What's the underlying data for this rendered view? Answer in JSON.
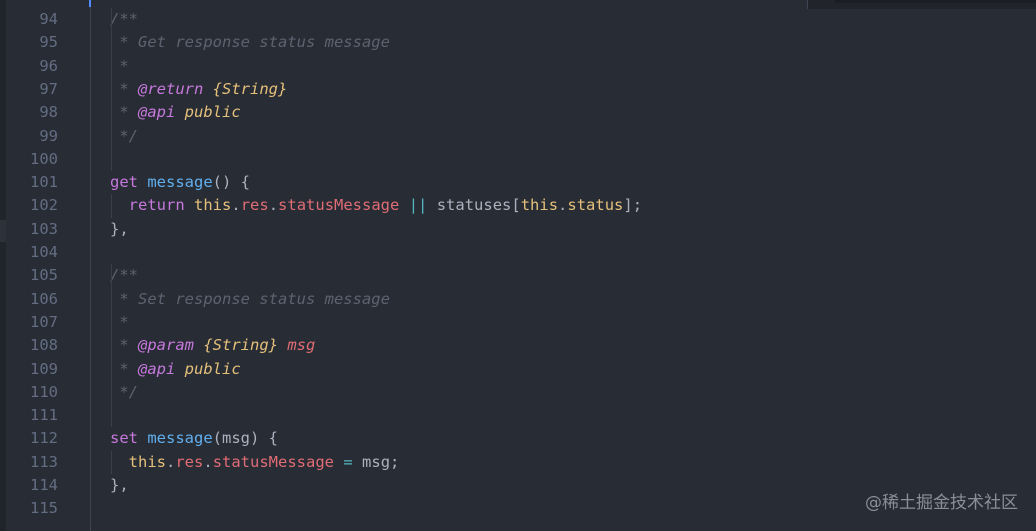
{
  "editor": {
    "lines": [
      {
        "number": "94",
        "tokens": [
          {
            "t": "/**",
            "c": "comment"
          }
        ]
      },
      {
        "number": "95",
        "tokens": [
          {
            "t": " * Get response status message",
            "c": "comment"
          }
        ]
      },
      {
        "number": "96",
        "tokens": [
          {
            "t": " *",
            "c": "comment"
          }
        ]
      },
      {
        "number": "97",
        "tokens": [
          {
            "t": " * ",
            "c": "comment"
          },
          {
            "t": "@return",
            "c": "tag"
          },
          {
            "t": " ",
            "c": "comment"
          },
          {
            "t": "{String}",
            "c": "type"
          }
        ]
      },
      {
        "number": "98",
        "tokens": [
          {
            "t": " * ",
            "c": "comment"
          },
          {
            "t": "@api",
            "c": "tag"
          },
          {
            "t": " ",
            "c": "comment"
          },
          {
            "t": "public",
            "c": "type"
          }
        ]
      },
      {
        "number": "99",
        "tokens": [
          {
            "t": " */",
            "c": "comment"
          }
        ]
      },
      {
        "number": "100",
        "tokens": []
      },
      {
        "number": "101",
        "tokens": [
          {
            "t": "get",
            "c": "keyword"
          },
          {
            "t": " ",
            "c": "plain"
          },
          {
            "t": "message",
            "c": "func"
          },
          {
            "t": "() {",
            "c": "plain"
          }
        ]
      },
      {
        "number": "102",
        "tokens": [
          {
            "t": "  ",
            "c": "plain"
          },
          {
            "t": "return",
            "c": "keyword"
          },
          {
            "t": " ",
            "c": "plain"
          },
          {
            "t": "this",
            "c": "this"
          },
          {
            "t": ".",
            "c": "plain"
          },
          {
            "t": "res",
            "c": "prop"
          },
          {
            "t": ".",
            "c": "plain"
          },
          {
            "t": "statusMessage",
            "c": "prop"
          },
          {
            "t": " ",
            "c": "plain"
          },
          {
            "t": "||",
            "c": "op"
          },
          {
            "t": " statuses[",
            "c": "plain"
          },
          {
            "t": "this",
            "c": "this"
          },
          {
            "t": ".",
            "c": "plain"
          },
          {
            "t": "status",
            "c": "this"
          },
          {
            "t": "];",
            "c": "plain"
          }
        ]
      },
      {
        "number": "103",
        "tokens": [
          {
            "t": "},",
            "c": "plain"
          }
        ]
      },
      {
        "number": "104",
        "tokens": []
      },
      {
        "number": "105",
        "tokens": [
          {
            "t": "/**",
            "c": "comment"
          }
        ]
      },
      {
        "number": "106",
        "tokens": [
          {
            "t": " * Set response status message",
            "c": "comment"
          }
        ]
      },
      {
        "number": "107",
        "tokens": [
          {
            "t": " *",
            "c": "comment"
          }
        ]
      },
      {
        "number": "108",
        "tokens": [
          {
            "t": " * ",
            "c": "comment"
          },
          {
            "t": "@param",
            "c": "tag"
          },
          {
            "t": " ",
            "c": "comment"
          },
          {
            "t": "{String}",
            "c": "type"
          },
          {
            "t": " ",
            "c": "comment"
          },
          {
            "t": "msg",
            "c": "param"
          }
        ]
      },
      {
        "number": "109",
        "tokens": [
          {
            "t": " * ",
            "c": "comment"
          },
          {
            "t": "@api",
            "c": "tag"
          },
          {
            "t": " ",
            "c": "comment"
          },
          {
            "t": "public",
            "c": "type"
          }
        ]
      },
      {
        "number": "110",
        "tokens": [
          {
            "t": " */",
            "c": "comment"
          }
        ]
      },
      {
        "number": "111",
        "tokens": []
      },
      {
        "number": "112",
        "tokens": [
          {
            "t": "set",
            "c": "keyword"
          },
          {
            "t": " ",
            "c": "plain"
          },
          {
            "t": "message",
            "c": "func"
          },
          {
            "t": "(msg) {",
            "c": "plain"
          }
        ]
      },
      {
        "number": "113",
        "tokens": [
          {
            "t": "  ",
            "c": "plain"
          },
          {
            "t": "this",
            "c": "this"
          },
          {
            "t": ".",
            "c": "plain"
          },
          {
            "t": "res",
            "c": "prop"
          },
          {
            "t": ".",
            "c": "plain"
          },
          {
            "t": "statusMessage",
            "c": "prop"
          },
          {
            "t": " ",
            "c": "plain"
          },
          {
            "t": "=",
            "c": "op"
          },
          {
            "t": " msg;",
            "c": "plain"
          }
        ]
      },
      {
        "number": "114",
        "tokens": [
          {
            "t": "},",
            "c": "plain"
          }
        ]
      },
      {
        "number": "115",
        "tokens": []
      }
    ]
  },
  "colors": {
    "background": "#282c34",
    "comment": "#5c6370",
    "keyword": "#c678dd",
    "function": "#61afef",
    "type": "#e5c07b",
    "property": "#e06c75",
    "operator": "#56b6c2",
    "plain": "#abb2bf",
    "line_number": "#636d83"
  },
  "watermark": {
    "text": "@稀土掘金技术社区"
  }
}
